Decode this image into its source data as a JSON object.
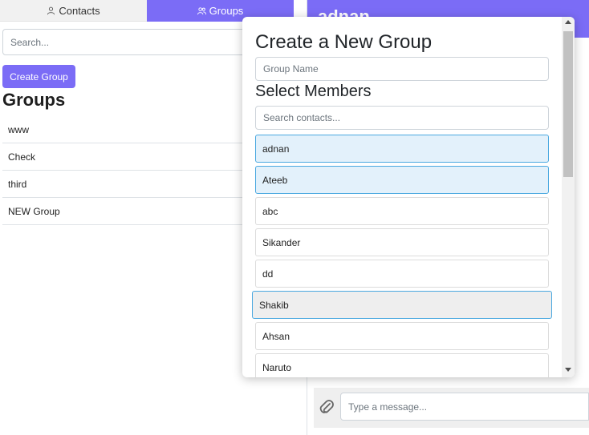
{
  "tabs": {
    "contacts_label": "Contacts",
    "groups_label": "Groups"
  },
  "sidebar": {
    "search_placeholder": "Search...",
    "create_group_label": "Create Group",
    "groups_heading": "Groups",
    "groups": [
      "www",
      "Check",
      "third",
      "NEW Group"
    ]
  },
  "chat": {
    "title": "adnan",
    "message_placeholder": "Type a message..."
  },
  "modal": {
    "title": "Create a New Group",
    "group_name_placeholder": "Group Name",
    "members_heading": "Select Members",
    "contacts_search_placeholder": "Search contacts...",
    "members": [
      {
        "name": "adnan",
        "selected": true
      },
      {
        "name": "Ateeb",
        "selected": true
      },
      {
        "name": "abc",
        "selected": false
      },
      {
        "name": "Sikander",
        "selected": false
      },
      {
        "name": "dd",
        "selected": false
      },
      {
        "name": "Shakib",
        "selected": false
      },
      {
        "name": "Ahsan",
        "selected": false
      },
      {
        "name": "Naruto",
        "selected": false
      }
    ]
  },
  "colors": {
    "accent": "#7b6cf6",
    "selected_bg": "#e3f1fb",
    "selected_border": "#4aa8e0"
  },
  "icons": {
    "contacts_tab": "user-icon",
    "groups_tab": "users-icon",
    "attach": "paperclip-icon"
  }
}
